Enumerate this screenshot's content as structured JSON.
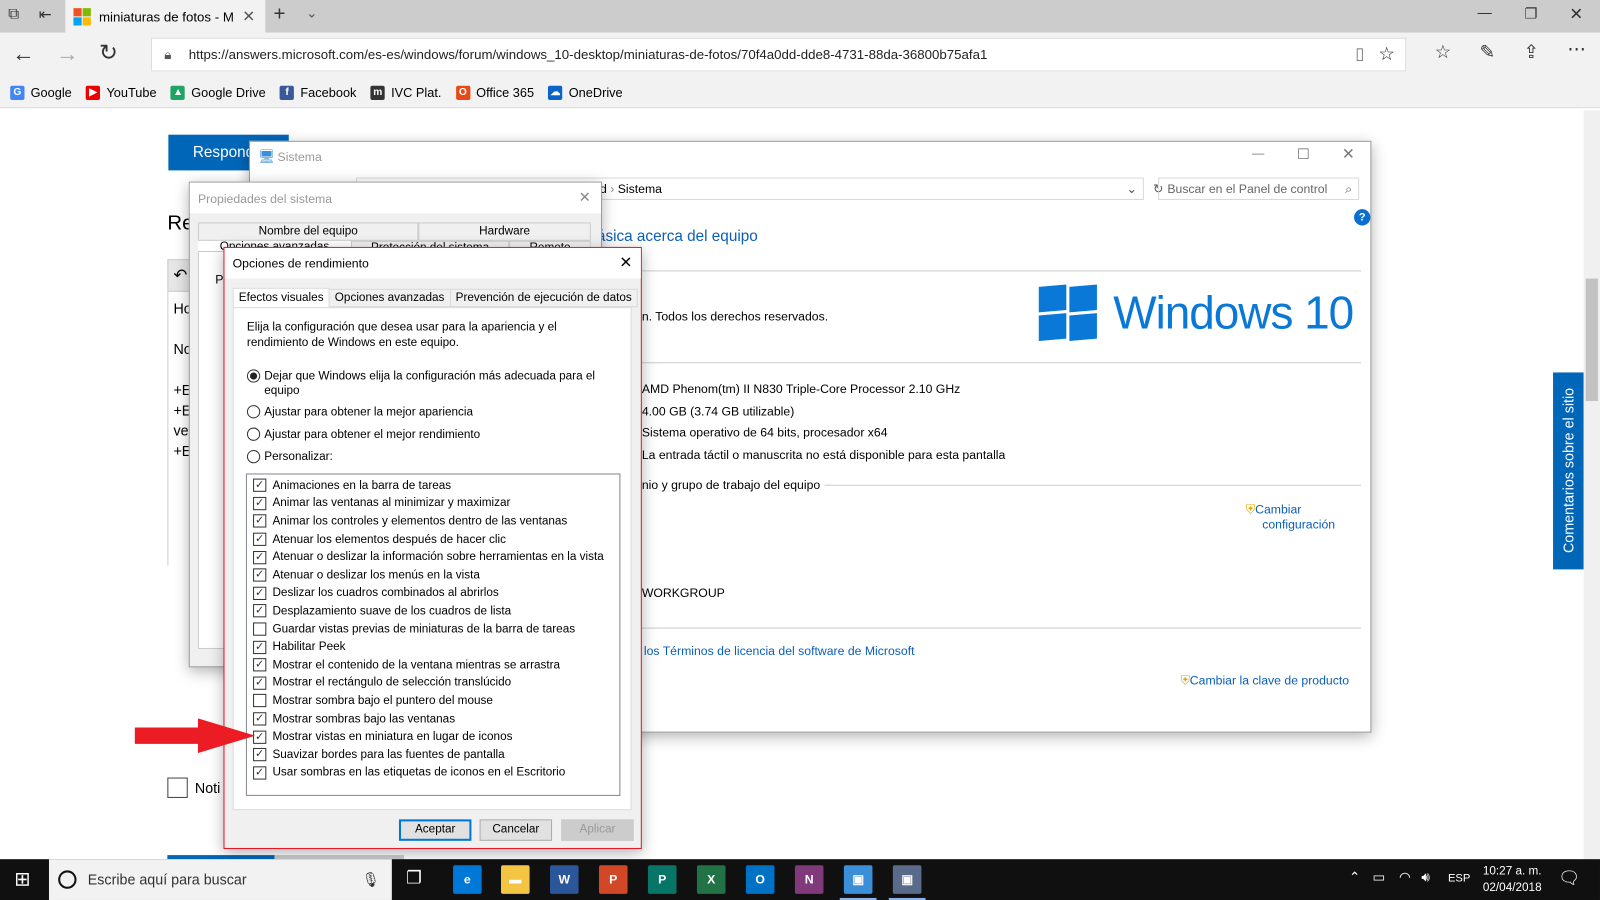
{
  "browser": {
    "tab_title": "miniaturas de fotos - M",
    "url": "https://answers.microsoft.com/es-es/windows/forum/windows_10-desktop/miniaturas-de-fotos/70f4a0dd-dde8-4731-88da-36800b75afa1",
    "favorites": [
      {
        "label": "Google",
        "icon": "google-icon",
        "color": "#4285f4"
      },
      {
        "label": "YouTube",
        "icon": "youtube-icon",
        "color": "#e00"
      },
      {
        "label": "Google Drive",
        "icon": "drive-icon",
        "color": "#1fa463"
      },
      {
        "label": "Facebook",
        "icon": "facebook-icon",
        "color": "#3b5998"
      },
      {
        "label": "IVC Plat.",
        "icon": "moodle-icon",
        "color": "#333"
      },
      {
        "label": "Office 365",
        "icon": "office-icon",
        "color": "#e64a19"
      },
      {
        "label": "OneDrive",
        "icon": "onedrive-icon",
        "color": "#0a64c8"
      }
    ]
  },
  "page": {
    "reply_button": "Respond",
    "heading": "Re",
    "lines": [
      "Ho",
      "No",
      "+E",
      "+E",
      "ve",
      "+E"
    ],
    "notify": "Noti",
    "feedback": "Comentarios sobre el sitio"
  },
  "sistema": {
    "title": "Sistema",
    "breadcrumb": [
      "d",
      "Sistema"
    ],
    "search_placeholder": "Buscar en el Panel de control",
    "heading": "ásica acerca del equipo",
    "copyright": "n. Todos los derechos reservados.",
    "logo_text": "Windows 10",
    "specs": [
      "AMD Phenom(tm) II N830 Triple-Core Processor   2.10 GHz",
      "4.00 GB (3.74 GB utilizable)",
      "Sistema operativo de 64 bits, procesador x64",
      "La entrada táctil o manuscrita no está disponible para esta pantalla"
    ],
    "section_domain": "nio y grupo de trabajo del equipo",
    "change_settings": [
      "Cambiar",
      "configuración"
    ],
    "workgroup": "WORKGROUP",
    "license_link": "los Términos de licencia del software de Microsoft",
    "change_key": "Cambiar la clave de producto"
  },
  "props": {
    "title": "Propiedades del sistema",
    "tabs_row1": [
      "Nombre del equipo",
      "Hardware"
    ],
    "tabs_row2": [
      "Opciones avanzadas",
      "Protección del sistema",
      "Remoto"
    ],
    "partial": "Pa"
  },
  "perf": {
    "title": "Opciones de rendimiento",
    "tabs": [
      "Efectos visuales",
      "Opciones avanzadas",
      "Prevención de ejecución de datos"
    ],
    "description": "Elija la configuración que desea usar para la apariencia y el rendimiento de Windows en este equipo.",
    "radios": [
      {
        "label": "Dejar que Windows elija la configuración más adecuada para el equipo",
        "selected": true
      },
      {
        "label": "Ajustar para obtener la mejor apariencia",
        "selected": false
      },
      {
        "label": "Ajustar para obtener el mejor rendimiento",
        "selected": false
      },
      {
        "label": "Personalizar:",
        "selected": false
      }
    ],
    "options": [
      {
        "label": "Animaciones en la barra de tareas",
        "checked": true
      },
      {
        "label": "Animar las ventanas al minimizar y maximizar",
        "checked": true
      },
      {
        "label": "Animar los controles y elementos dentro de las ventanas",
        "checked": true
      },
      {
        "label": "Atenuar los elementos después de hacer clic",
        "checked": true
      },
      {
        "label": "Atenuar o deslizar la información sobre herramientas en la vista",
        "checked": true
      },
      {
        "label": "Atenuar o deslizar los menús en la vista",
        "checked": true
      },
      {
        "label": "Deslizar los cuadros combinados al abrirlos",
        "checked": true
      },
      {
        "label": "Desplazamiento suave de los cuadros de lista",
        "checked": true
      },
      {
        "label": "Guardar vistas previas de miniaturas de la barra de tareas",
        "checked": false
      },
      {
        "label": "Habilitar Peek",
        "checked": true
      },
      {
        "label": "Mostrar el contenido de la ventana mientras se arrastra",
        "checked": true
      },
      {
        "label": "Mostrar el rectángulo de selección translúcido",
        "checked": true
      },
      {
        "label": "Mostrar sombra bajo el puntero del mouse",
        "checked": false
      },
      {
        "label": "Mostrar sombras bajo las ventanas",
        "checked": true
      },
      {
        "label": "Mostrar vistas en miniatura en lugar de iconos",
        "checked": true
      },
      {
        "label": "Suavizar bordes para las fuentes de pantalla",
        "checked": true
      },
      {
        "label": "Usar sombras en las etiquetas de iconos en el Escritorio",
        "checked": true
      }
    ],
    "ok": "Aceptar",
    "cancel": "Cancelar",
    "apply": "Aplicar",
    "highlight_color": "#e81123"
  },
  "taskbar": {
    "search_placeholder": "Escribe aquí para buscar",
    "apps": [
      {
        "name": "edge",
        "glyph": "e",
        "color": "#0078d7"
      },
      {
        "name": "file-explorer",
        "glyph": "▬",
        "color": "#f4c542"
      },
      {
        "name": "word",
        "glyph": "W",
        "color": "#2b579a"
      },
      {
        "name": "powerpoint",
        "glyph": "P",
        "color": "#d24726"
      },
      {
        "name": "publisher",
        "glyph": "P",
        "color": "#077568"
      },
      {
        "name": "excel",
        "glyph": "X",
        "color": "#217346"
      },
      {
        "name": "outlook",
        "glyph": "O",
        "color": "#0072c6"
      },
      {
        "name": "onenote",
        "glyph": "N",
        "color": "#80397b"
      },
      {
        "name": "control-panel",
        "glyph": "▣",
        "color": "#3a8fd8"
      },
      {
        "name": "system-properties",
        "glyph": "▣",
        "color": "#5a6a8a"
      }
    ],
    "language": "ESP",
    "time": "10:27 a. m.",
    "date": "02/04/2018"
  }
}
